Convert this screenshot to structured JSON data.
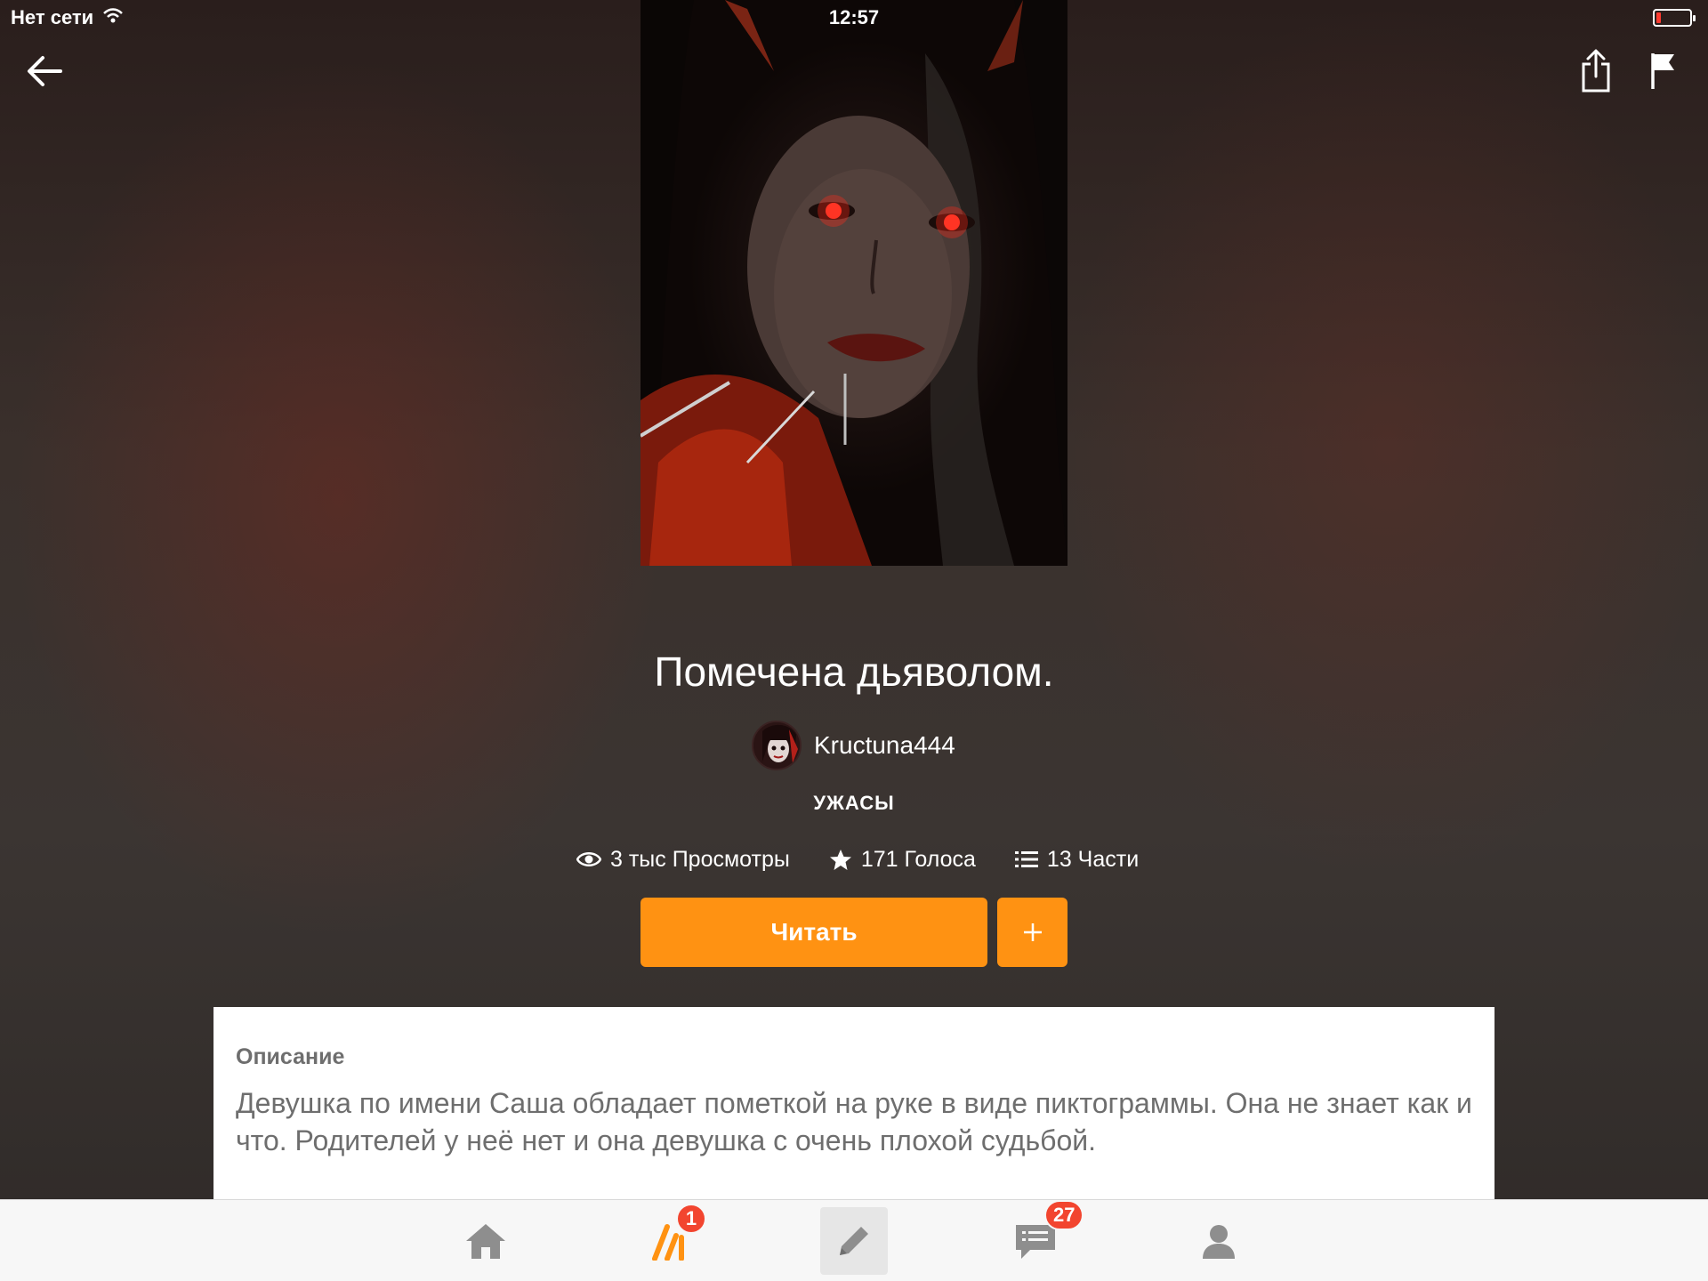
{
  "status_bar": {
    "carrier": "Нет сети",
    "time": "12:57",
    "battery_color": "#ff3b30"
  },
  "top_actions": {
    "back_icon": "arrow-left-icon",
    "share_icon": "share-icon",
    "report_icon": "flag-icon"
  },
  "story": {
    "title": "Помечена дьяволом.",
    "author": "Kructuna444",
    "genre": "УЖАСЫ",
    "stats": {
      "views": "3 тыс Просмотры",
      "votes": "171 Голоса",
      "parts": "13 Части"
    }
  },
  "actions": {
    "read_label": "Читать",
    "add_label": "+",
    "accent_color": "#ff9212"
  },
  "description": {
    "heading": "Описание",
    "text": "Девушка по имени Саша обладает пометкой на руке в виде пиктограммы. Она не знает как и что. Родителей  у неё нет и она девушка с очень плохой  судьбой."
  },
  "tab_bar": {
    "tabs": [
      {
        "name": "home",
        "icon": "home-icon"
      },
      {
        "name": "library",
        "icon": "library-icon",
        "badge": "1"
      },
      {
        "name": "write",
        "icon": "pencil-icon"
      },
      {
        "name": "messages",
        "icon": "chat-icon",
        "badge": "27"
      },
      {
        "name": "profile",
        "icon": "user-icon"
      }
    ]
  }
}
